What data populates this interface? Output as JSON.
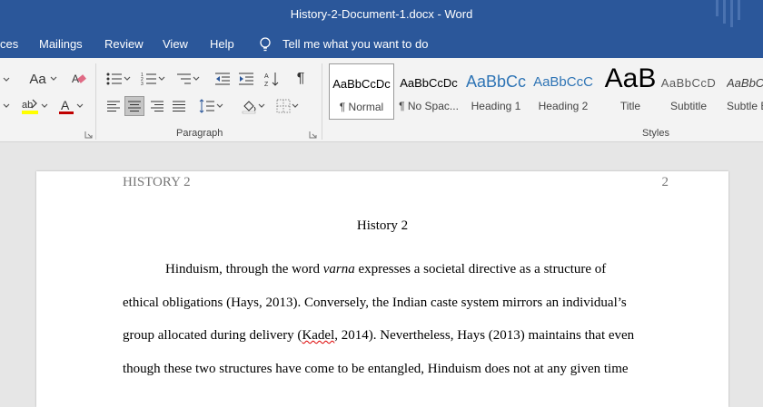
{
  "window": {
    "title": "History-2-Document-1.docx  -  Word"
  },
  "menu": {
    "items": [
      "ces",
      "Mailings",
      "Review",
      "View",
      "Help"
    ],
    "tell_me": "Tell me what you want to do"
  },
  "ribbon": {
    "font_group": {
      "aa_label": "Aa"
    },
    "paragraph_group_label": "Paragraph",
    "styles_group_label": "Styles",
    "styles": [
      {
        "preview": "AaBbCcDc",
        "name": "¶ Normal"
      },
      {
        "preview": "AaBbCcDc",
        "name": "¶ No Spac..."
      },
      {
        "preview": "AaBbCc",
        "name": "Heading 1"
      },
      {
        "preview": "AaBbCcC",
        "name": "Heading 2"
      },
      {
        "preview": "AaB",
        "name": "Title"
      },
      {
        "preview": "AaBbCcD",
        "name": "Subtitle"
      },
      {
        "preview": "AaBbC",
        "name": "Subtle E"
      }
    ],
    "colors": {
      "highlight": "#ffff00",
      "font_color": "#c00000"
    }
  },
  "document": {
    "header_left": "HISTORY 2",
    "header_page": "2",
    "title": "History 2",
    "lines": {
      "l1_a": "Hinduism, through the word ",
      "l1_italic": "varna",
      "l1_b": " expresses a societal directive as a structure of",
      "l2": "ethical obligations (Hays, 2013). Conversely, the Indian caste system mirrors an individual’s",
      "l3_a": "group allocated during delivery (",
      "l3_sq": "Kadel",
      "l3_b": ", 2014). Nevertheless, Hays (2013) maintains that even",
      "l4": "though these two structures have come to be entangled, Hinduism does not at any given time"
    }
  }
}
